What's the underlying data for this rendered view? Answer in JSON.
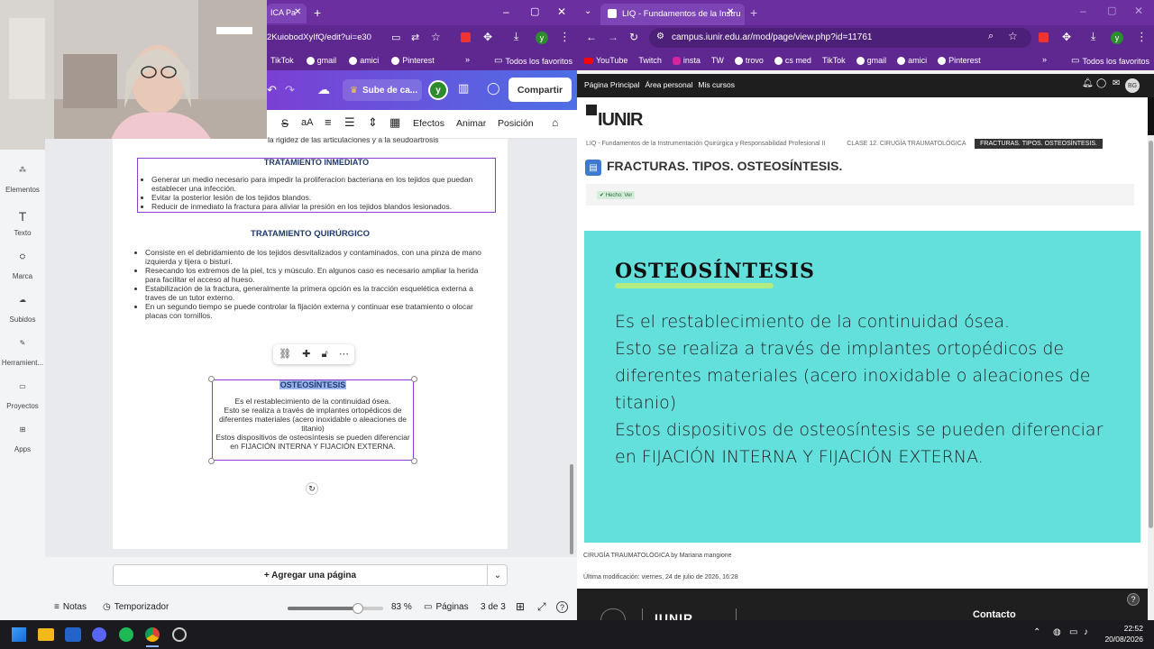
{
  "left_browser": {
    "tab_title": "ICA Pa",
    "url": "2KuiobodXyIfQ/edit?ui=e30",
    "profile_initial": "y",
    "bookmarks": [
      "TikTok",
      "gmail",
      "amici",
      "Pinterest"
    ],
    "bookmarks_more": "»",
    "favorites_label": "Todos los favoritos",
    "window_min": "–",
    "window_max": "▢",
    "window_close": "✕",
    "new_tab": "+"
  },
  "canva": {
    "upgrade_label": "Sube de ca...",
    "share_label": "Compartir",
    "avatar": "y",
    "toolbar": {
      "effects": "Efectos",
      "animate": "Animar",
      "position": "Posición",
      "font_size_icon": "aA"
    },
    "sidebar": [
      {
        "label": "Elementos",
        "icon": "elements-icon"
      },
      {
        "label": "Texto",
        "icon": "text-icon"
      },
      {
        "label": "Marca",
        "icon": "brand-icon"
      },
      {
        "label": "Subidos",
        "icon": "uploads-icon"
      },
      {
        "label": "Herramient...",
        "icon": "tools-icon"
      },
      {
        "label": "Proyectos",
        "icon": "projects-icon"
      },
      {
        "label": "Apps",
        "icon": "apps-icon"
      }
    ],
    "doc": {
      "top_line": "la rigidez de las articulaciones y a la seudoartrosis",
      "section1_title": "TRATAMIENTO INMEDIATO",
      "section1_items": [
        "Generar un medio necesario para impedir la proliferacion bacteriana en los tejidos que puedan establecer una infección.",
        "Evitar la posterior lesión de los tejidos blandos.",
        "Reducir de inmediato la fractura para aliviar la presión en los tejidos blandos lesionados."
      ],
      "section2_title": "TRATAMIENTO QUIRÚRGICO",
      "section2_items": [
        "Consiste en el debridamiento de los tejidos desvitalizados y contaminados, con una pinza de mano izquierda y tijera o bisturí.",
        "Resecando los extremos de la piel, tcs y músculo. En algunos caso es necesario ampliar la herida para facilitar el acceso al hueso.",
        "Estabilización de la fractura, generalmente la primera opción es la tracción esquelética externa a traves de un tutor externo.",
        "En un segundo tiempo se puede controlar la fijación externa y continuar ese tratamiento o olocar placas con tornillos."
      ],
      "section3_title": "OSTEOSÍNTESIS",
      "section3_text": [
        "Es el restablecimiento de la continuidad ósea.",
        "Esto se realiza a través de implantes ortopédicos de diferentes materiales (acero inoxidable o aleaciones de titanio)",
        "Estos dispositivos de osteosíntesis se pueden diferenciar en FIJACIÓN INTERNA Y FIJACIÓN EXTERNA."
      ]
    },
    "add_page_label": "+ Agregar una página",
    "bottom": {
      "notes": "Notas",
      "timer": "Temporizador",
      "zoom": "83 %",
      "pages": "Páginas",
      "page_count": "3 de 3",
      "zoom_fraction": 0.74
    }
  },
  "right_browser": {
    "tab_title": "LIQ - Fundamentos de la Instru",
    "url": "campus.iunir.edu.ar/mod/page/view.php?id=11761",
    "profile_initial": "y",
    "bookmarks": [
      "YouTube",
      "Twitch",
      "insta",
      "TW",
      "trovo",
      "cs med",
      "TikTok",
      "gmail",
      "amici",
      "Pinterest"
    ],
    "bookmarks_more": "»",
    "favorites_label": "Todos los favoritos",
    "new_tab": "+"
  },
  "moodle": {
    "nav": [
      "Página Principal",
      "Área personal",
      "Mis cursos"
    ],
    "user_initials": "BG",
    "logo_text": "IUNIR",
    "breadcrumb": [
      "LIQ - Fundamentos de la Instrumentación Quirúrgica y Responsabilidad Profesional II",
      "CLASE 12. CIRUGÍA TRAUMATOLÓGICA",
      "FRACTURAS. TIPOS. OSTEOSÍNTESIS."
    ],
    "page_title": "FRACTURAS. TIPOS. OSTEOSÍNTESIS.",
    "done_badge": "✔ Hecho: Ver",
    "slide": {
      "title": "OSTEOSÍNTESIS",
      "lines": [
        "Es el restablecimiento de la continuidad ósea.",
        "Esto se realiza a través de implantes ortopédicos de diferentes materiales (acero inoxidable o aleaciones de titanio)",
        "Estos dispositivos de osteosíntesis se pueden diferenciar en FIJACIÓN INTERNA Y FIJACIÓN EXTERNA."
      ],
      "bg_color": "#63e0dc"
    },
    "caption": "CIRUGÍA TRAUMATOLÓGICA by Mariana mangione",
    "last_modified": "Última modificación: viernes, 24 de julio de 2026, 16:28",
    "footer_contact": "Contacto",
    "footer_logo": "IUNIR",
    "help": "?"
  },
  "taskbar": {
    "time": "22:52",
    "date": "20/08/2026"
  }
}
